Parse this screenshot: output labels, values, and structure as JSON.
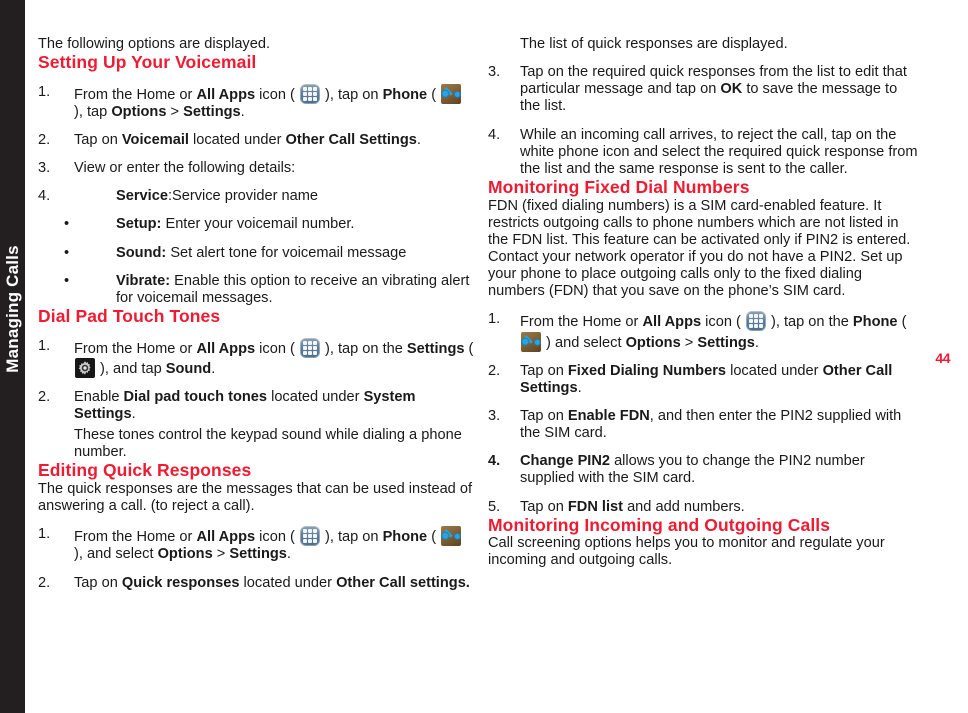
{
  "sidebar": {
    "chapter_label": "Managing Calls"
  },
  "page_number": "44",
  "colors": {
    "accent_red": "#ed1c32",
    "sidebar_dark": "#231f20",
    "body_text": "#1a1a1a"
  },
  "icons": {
    "all_apps": "all-apps-icon",
    "phone": "phone-icon",
    "settings": "settings-gear-icon"
  },
  "left_column": {
    "intro": "The following options are displayed.",
    "voicemail": {
      "heading": "Setting Up Your Voicemail",
      "step1": {
        "marker": "1.",
        "part_a": "From the Home or ",
        "bold_a": "All Apps",
        "part_b": " icon ( ",
        "part_c": " ), tap on ",
        "bold_b": "Phone",
        "part_d": " ( ",
        "part_e": " ), tap ",
        "bold_c": "Options",
        "part_f": " > ",
        "bold_d": "Settings",
        "part_g": "."
      },
      "step2": {
        "marker": "2.",
        "part_a": "Tap on ",
        "bold_a": "Voicemail",
        "part_b": " located under ",
        "bold_b": "Other Call Settings",
        "part_c": "."
      },
      "step3": {
        "marker": "3.",
        "text": "View or enter the following details:"
      },
      "step4": {
        "marker": "4.",
        "bold_a": "Service",
        "part_a": ":Service provider name"
      },
      "bullets": [
        {
          "marker": "•",
          "bold": "Setup:",
          "text": " Enter your voicemail number."
        },
        {
          "marker": "•",
          "bold": "Sound:",
          "text": " Set alert tone for voicemail message"
        },
        {
          "marker": "•",
          "bold": "Vibrate:",
          "text": " Enable this option to receive an vibrating alert for voicemail messages."
        }
      ]
    },
    "dial_pad": {
      "heading": "Dial Pad Touch Tones",
      "step1": {
        "marker": "1.",
        "part_a": "From the Home or ",
        "bold_a": "All Apps",
        "part_b": " icon ( ",
        "part_c": " ), tap on the ",
        "bold_b": "Settings",
        "part_d": " ( ",
        "part_e": " ), and tap ",
        "bold_c": "Sound",
        "part_f": "."
      },
      "step2": {
        "marker": "2.",
        "part_a": "Enable ",
        "bold_a": "Dial pad touch tones",
        "part_b": " located under ",
        "bold_b": "System Settings",
        "part_c": "."
      },
      "note": "These tones control the keypad sound while dialing a phone number."
    },
    "quick_responses": {
      "heading": "Editing Quick Responses",
      "intro": "The quick responses are the messages that can be used instead of answering a call. (to reject a call).",
      "step1": {
        "marker": "1.",
        "part_a": "From the Home or ",
        "bold_a": "All Apps",
        "part_b": " icon ( ",
        "part_c": " ), tap on ",
        "bold_b": "Phone",
        "part_d": " ( ",
        "part_e": " ), and select ",
        "bold_c": "Options",
        "part_f": " > ",
        "bold_d": "Settings",
        "part_g": "."
      },
      "step2": {
        "marker": "2.",
        "part_a": "Tap on ",
        "bold_a": "Quick responses",
        "part_b": " located under ",
        "bold_b": "Other Call settings."
      }
    }
  },
  "right_column": {
    "quick_responses_cont": {
      "note": "The list of quick responses are displayed.",
      "step3": {
        "marker": "3.",
        "part_a": "Tap on the required quick responses from the list to edit that particular message and tap on ",
        "bold_a": "OK",
        "part_b": " to save the message to the list."
      },
      "step4": {
        "marker": "4.",
        "text": "While an incoming call arrives, to reject the call, tap on the white phone icon and select the required quick response from the list and the same response is sent to the caller."
      }
    },
    "fixed_dial": {
      "heading": "Monitoring Fixed Dial Numbers",
      "intro": "FDN (fixed dialing numbers) is a SIM card-enabled feature. It restricts outgoing calls to phone numbers which are not listed in the FDN list. This feature can be activated only if PIN2 is entered. Contact your network operator if you do not have a PIN2. Set up your phone to place outgoing calls only to the fixed dialing numbers (FDN) that you save on the phone’s SIM card.",
      "step1": {
        "marker": "1.",
        "part_a": "From the Home or ",
        "bold_a": "All Apps",
        "part_b": " icon ( ",
        "part_c": " ), tap on the ",
        "bold_b": "Phone",
        "part_d": " ( ",
        "part_e": " ) and select ",
        "bold_c": "Options",
        "part_f": " > ",
        "bold_d": "Settings",
        "part_g": "."
      },
      "step2": {
        "marker": "2.",
        "part_a": "Tap on ",
        "bold_a": "Fixed Dialing Numbers",
        "part_b": " located under ",
        "bold_b": "Other Call Settings",
        "part_c": "."
      },
      "step3": {
        "marker": "3.",
        "part_a": "Tap on ",
        "bold_a": "Enable FDN",
        "part_b": ", and then enter the PIN2 supplied with the SIM card."
      },
      "step4": {
        "marker": "4.",
        "bold_a": "Change PIN2",
        "part_a": " allows you to change the PIN2 number supplied with the SIM card."
      },
      "step5": {
        "marker": "5.",
        "part_a": "Tap on ",
        "bold_a": "FDN list",
        "part_b": " and add numbers."
      }
    },
    "incoming_outgoing": {
      "heading": "Monitoring Incoming and Outgoing Calls",
      "intro": "Call screening options helps you to monitor and regulate your incoming and outgoing calls."
    }
  }
}
